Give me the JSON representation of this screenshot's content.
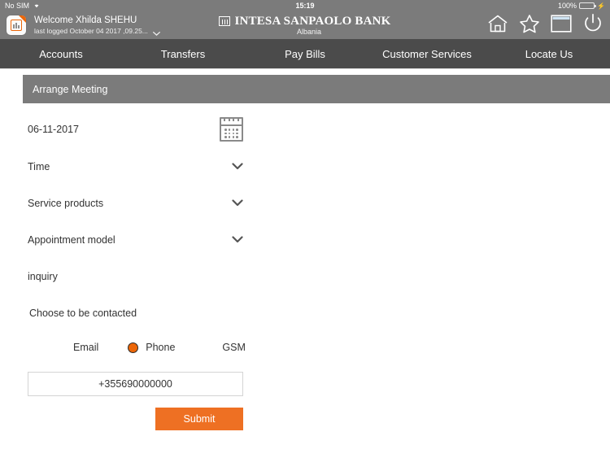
{
  "status_bar": {
    "carrier": "No SIM",
    "wifi_icon": "wifi-icon",
    "time": "15:19",
    "battery_percent": "100%",
    "battery_level": 100,
    "charging_icon": "lightning-bolt-icon"
  },
  "header": {
    "app_icon": "bank-app-icon",
    "welcome": "Welcome Xhilda SHEHU",
    "last_logged": "last logged  October 04 2017 ,09.25...",
    "expand_icon": "chevron-down-icon",
    "brand_mark_icon": "intesa-sanpaolo-logo-icon",
    "brand_name": "INTESA SANPAOLO BANK",
    "brand_country": "Albania",
    "icons": [
      {
        "name": "home-icon"
      },
      {
        "name": "star-icon"
      },
      {
        "name": "window-icon"
      },
      {
        "name": "power-icon"
      }
    ]
  },
  "nav": {
    "items": [
      {
        "label": "Accounts"
      },
      {
        "label": "Transfers"
      },
      {
        "label": "Pay Bills"
      },
      {
        "label": "Customer Services"
      },
      {
        "label": "Locate Us"
      }
    ]
  },
  "section": {
    "title": "Arrange Meeting"
  },
  "form": {
    "date_value": "06-11-2017",
    "calendar_icon": "calendar-icon",
    "time_label": "Time",
    "service_products_label": "Service products",
    "appointment_model_label": "Appointment model",
    "inquiry_label": "inquiry",
    "dropdown_icon": "chevron-down-icon",
    "choose_label": "Choose to be contacted",
    "contact_options": [
      {
        "label": "Email",
        "selected": false,
        "radio_visible": false
      },
      {
        "label": "Phone",
        "selected": true,
        "radio_visible": true
      },
      {
        "label": "GSM",
        "selected": false,
        "radio_visible": false
      }
    ],
    "phone_value": "+355690000000",
    "phone_placeholder": "+355690000000",
    "submit_label": "Submit"
  },
  "colors": {
    "header_gray": "#7b7b7b",
    "nav_gray": "#4b4b4b",
    "accent_orange": "#ee7023",
    "radio_orange": "#ec6608",
    "battery_green": "#53d769"
  }
}
